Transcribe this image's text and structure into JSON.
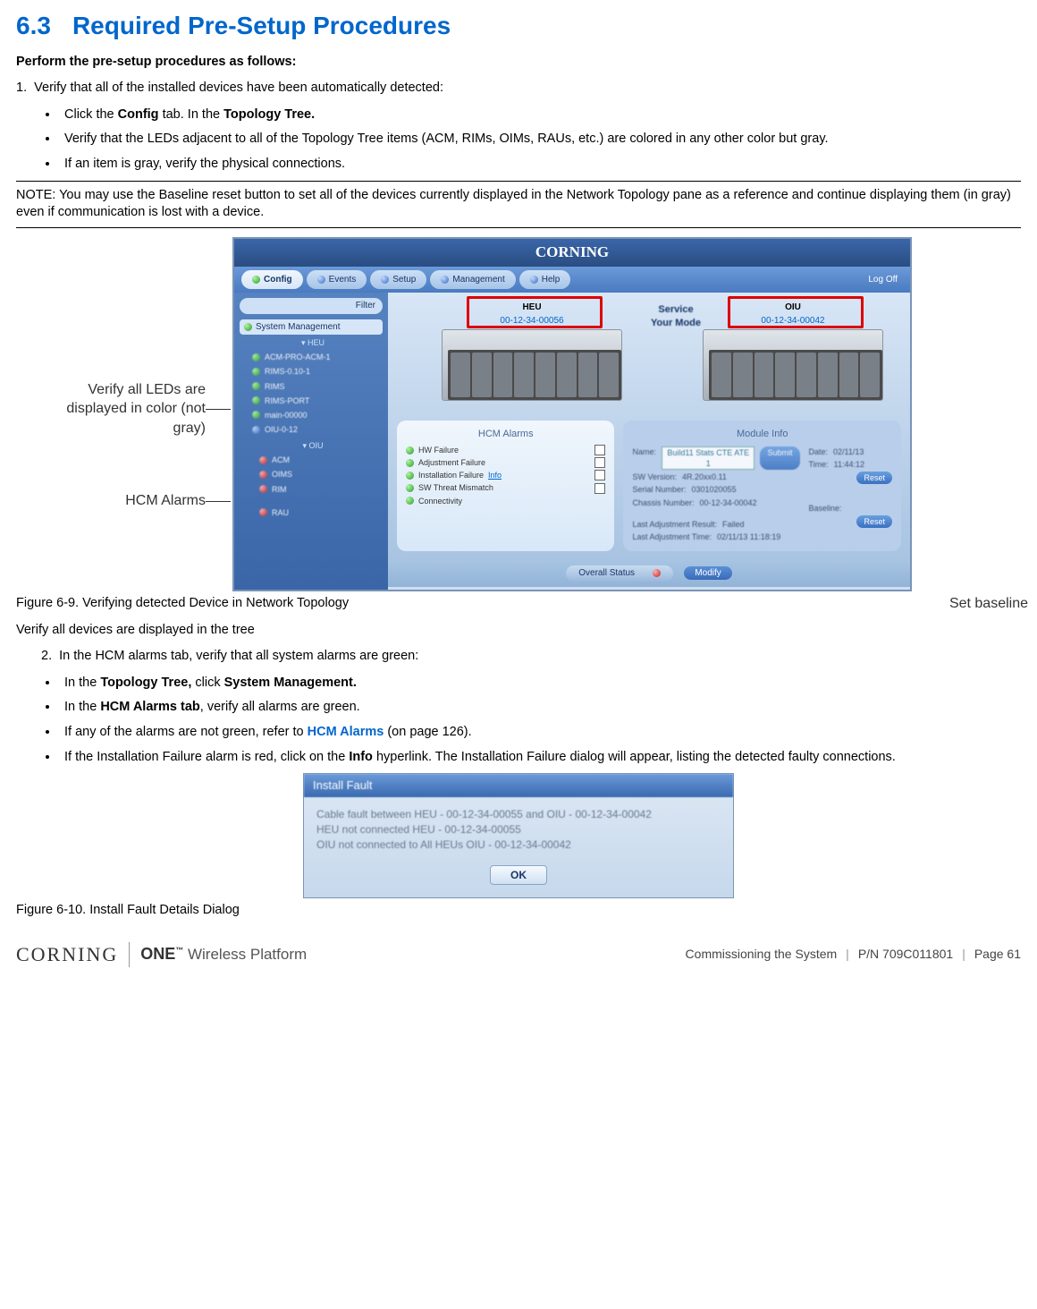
{
  "heading": {
    "number": "6.3",
    "title": "Required Pre-Setup Procedures"
  },
  "intro": "Perform the pre-setup procedures as follows:",
  "step1": {
    "num": "1.",
    "text": "Verify that all of the installed devices have been automatically detected:"
  },
  "bullets1": {
    "b1_pre": "Click the ",
    "b1_bold1": "Config",
    "b1_mid": " tab. In the ",
    "b1_bold2": "Topology Tree.",
    "b2": "Verify that the LEDs adjacent to all of the Topology Tree items (ACM, RIMs, OIMs, RAUs, etc.) are colored in any other color but gray.",
    "b3": "If an item is gray, verify the physical connections."
  },
  "note": "NOTE: You may use the Baseline reset button to set all of the devices currently displayed in the Network Topology pane as a reference and continue displaying them (in gray) even if communication is lost with a device.",
  "callouts": {
    "leds": "Verify all LEDs are displayed in color (not gray)",
    "hcm": "HCM Alarms",
    "baseline": "Set baseline"
  },
  "app": {
    "brand": "CORNING",
    "tabs": {
      "config": "Config",
      "events": "Events",
      "setup": "Setup",
      "management": "Management",
      "help": "Help"
    },
    "logoff": "Log Off",
    "filter": "Filter",
    "tree_root": "System Management",
    "tree": {
      "t1": "ACM-PRO-ACM-1",
      "t2": "RIMS-0.10-1",
      "t3": "RIMS",
      "t4": "RIMS-PORT",
      "t5": "main-00000",
      "t6": "OIU-0-12",
      "oiu": "OIU",
      "acm": "ACM",
      "oims": "OIMS",
      "rim": "RIM",
      "rau": "RAU"
    },
    "heu": {
      "label": "HEU",
      "serial": "00-12-34-00056"
    },
    "oiu": {
      "label": "OIU",
      "serial": "00-12-34-00042"
    },
    "service_mode": "Service Your Mode",
    "panel_alarms_title": "HCM Alarms",
    "alarms": {
      "a1": "HW Failure",
      "a2": "Adjustment Failure",
      "a3": "Installation Failure",
      "info": "Info",
      "a4": "SW Threat Mismatch",
      "a5": "Connectivity"
    },
    "module_title": "Module Info",
    "module": {
      "name_lbl": "Name:",
      "name_val": "Build11 Stats CTE ATE 1",
      "submit": "Submit",
      "sw_lbl": "SW Version:",
      "sw_val": "4R.20xx0.11",
      "ser_lbl": "Serial Number:",
      "ser_val": "0301020055",
      "ch_lbl": "Chassis Number:",
      "ch_val": "00-12-34-00042",
      "la_lbl": "Last Adjustment Result:",
      "la_val": "Failed",
      "lat_lbl": "Last Adjustment Time:",
      "lat_val": "02/11/13 11:18:19",
      "reset": "Reset",
      "baseline": "Reset",
      "date_lbl": "Date:",
      "date_val": "02/11/13",
      "time_lbl": "Time:",
      "time_val": "11:44:12",
      "baseline_lbl": "Baseline:"
    },
    "overall_label": "Overall Status",
    "modify": "Modify"
  },
  "fig1_caption": "Figure 6-9. Verifying detected Device in Network Topology",
  "verify_line": "Verify all devices are displayed in the tree",
  "step2": {
    "num": "2.",
    "text": "In the HCM alarms tab, verify that all system alarms are green:"
  },
  "bullets2": {
    "b1_pre": "In the ",
    "b1_bold1": "Topology Tree,",
    "b1_mid": " click ",
    "b1_bold2": "System Management.",
    "b2_pre": "In the ",
    "b2_bold": "HCM Alarms tab",
    "b2_post": ", verify all alarms are green.",
    "b3_pre": "If any of the alarms are not green, refer to ",
    "b3_link": "HCM Alarms",
    "b3_post": " (on page 126).",
    "b4_pre": "If the Installation Failure alarm is red, click on the ",
    "b4_bold": "Info",
    "b4_post": " hyperlink. The Installation Failure dialog will appear, listing the detected faulty connections."
  },
  "fault": {
    "title": "Install Fault",
    "l1": "Cable fault between HEU - 00-12-34-00055 and OIU - 00-12-34-00042",
    "l2": "HEU not connected HEU - 00-12-34-00055",
    "l3": "OIU not connected to All HEUs OIU - 00-12-34-00042",
    "ok": "OK"
  },
  "fig2_caption": "Figure 6-10. Install Fault Details Dialog",
  "footer": {
    "corning": "CORNING",
    "one": "ONE",
    "tm": "™",
    "one_sub": " Wireless Platform",
    "section": "Commissioning the System",
    "pn": "P/N 709C011801",
    "page": "Page 61"
  }
}
